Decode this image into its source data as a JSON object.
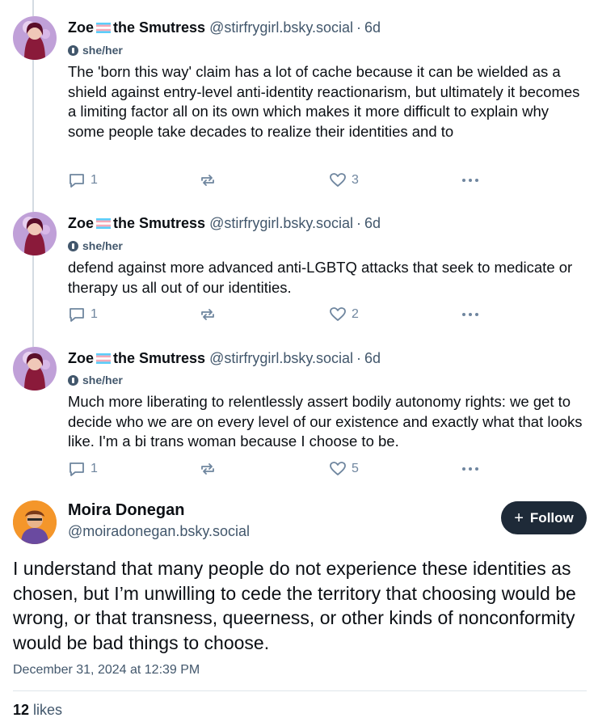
{
  "colors": {
    "text_primary": "#0b0f14",
    "text_secondary": "#42576c",
    "icon_muted": "#6f869f",
    "thread_line": "#d4dbe2",
    "follow_button_bg": "#1e2a38",
    "trans_flag_blue": "#5bcefa",
    "trans_flag_pink": "#f5a9b8"
  },
  "thread_posts": [
    {
      "display_name_first": "Zoe",
      "display_name_rest": "the Smutress",
      "handle": "@stirfrygirl.bsky.social",
      "separator": "·",
      "time": "6d",
      "pronouns": "she/her",
      "text": "The 'born this way' claim has a lot of cache because it can be wielded as a shield against entry-level anti-identity reactionarism, but ultimately it becomes a limiting factor all on its own which makes it more difficult to explain why some people take decades to realize their identities and to",
      "replies": "1",
      "likes": "3"
    },
    {
      "display_name_first": "Zoe",
      "display_name_rest": "the Smutress",
      "handle": "@stirfrygirl.bsky.social",
      "separator": "·",
      "time": "6d",
      "pronouns": "she/her",
      "text": "defend against more advanced anti-LGBTQ attacks that seek to medicate or therapy us all out of our identities.",
      "replies": "1",
      "likes": "2"
    },
    {
      "display_name_first": "Zoe",
      "display_name_rest": "the Smutress",
      "handle": "@stirfrygirl.bsky.social",
      "separator": "·",
      "time": "6d",
      "pronouns": "she/her",
      "text": "Much more liberating to relentlessly assert bodily autonomy rights: we get to decide who we are on every level of our existence and exactly what that looks like. I'm a bi trans woman because I choose to be.",
      "replies": "1",
      "likes": "5"
    }
  ],
  "main_post": {
    "display_name": "Moira Donegan",
    "handle": "@moiradonegan.bsky.social",
    "follow_plus": "+",
    "follow_label": "Follow",
    "text": "I understand that many people do not experience these identities as chosen, but I’m unwilling to cede the territory that choosing would be wrong, or that transness, queerness, or other kinds of nonconformity would be bad things to choose.",
    "date": "December 31, 2024 at 12:39 PM",
    "likes_count": "12",
    "likes_label": "likes"
  }
}
